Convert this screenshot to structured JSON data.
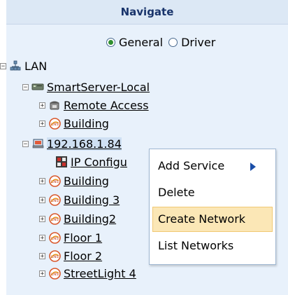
{
  "header": {
    "title": "Navigate"
  },
  "view_mode": {
    "options": [
      {
        "label": "General",
        "checked": true
      },
      {
        "label": "Driver",
        "checked": false
      }
    ]
  },
  "tree": {
    "root": {
      "label": "LAN",
      "expander": "⊟"
    },
    "server": {
      "label": "SmartServer-Local",
      "expander": "⊟"
    },
    "remote_access": {
      "label": "Remote Access",
      "expander": "⊞"
    },
    "building_a": {
      "label": "Building",
      "expander": "⊞"
    },
    "ip_node": {
      "label": "192.168.1.84",
      "expander": "⊟"
    },
    "ip_config": {
      "label": "IP Configu"
    },
    "building_b": {
      "label": "Building",
      "expander": "⊞"
    },
    "building_3": {
      "label": "Building 3",
      "expander": "⊞"
    },
    "building2": {
      "label": "Building2",
      "expander": "⊞"
    },
    "floor_1": {
      "label": "Floor 1",
      "expander": "⊞"
    },
    "floor_2": {
      "label": "Floor 2",
      "expander": "⊞"
    },
    "streetlight_4": {
      "label": "StreetLight 4",
      "expander": "⊞"
    }
  },
  "context_menu": {
    "items": [
      {
        "label": "Add Service",
        "has_submenu": true
      },
      {
        "label": "Delete"
      },
      {
        "label": "Create Network",
        "highlighted": true
      },
      {
        "label": "List Networks"
      }
    ]
  },
  "colors": {
    "panel_bg": "#e8f1fb",
    "header_text": "#19346b",
    "menu_highlight": "#fbe7b6",
    "submenu_arrow": "#1a4ea8"
  }
}
